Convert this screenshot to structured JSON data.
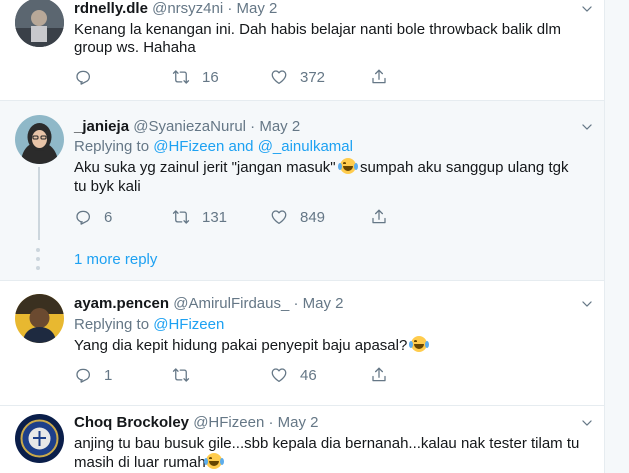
{
  "tweets": [
    {
      "name": "rdnelly.dle",
      "handle": "@nrsyz4ni",
      "dot": "·",
      "date": "May 2",
      "text_lines": [
        "Kenang la kenangan ini. Dah habis belajar nanti bole throwback balik dlm",
        "group ws. Hahaha"
      ],
      "retweets": "16",
      "likes": "372"
    },
    {
      "name": "_janieja",
      "handle": "@SyaniezaNurul",
      "dot": "·",
      "date": "May 2",
      "replying_prefix": "Replying to",
      "replying_1": "@HFizeen",
      "replying_and": "and",
      "replying_2": "@_ainulkamal",
      "text_line1_a": "Aku suka yg zainul jerit \"jangan masuk\"",
      "text_line1_b": "sumpah aku sanggup ulang tgk",
      "text_line2": "tu byk kali",
      "replies": "6",
      "retweets": "131",
      "likes": "849"
    },
    {
      "name": "ayam.pencen",
      "handle": "@AmirulFirdaus_",
      "dot": "·",
      "date": "May 2",
      "replying_prefix": "Replying to",
      "replying_1": "@HFizeen",
      "text": "Yang dia kepit hidung pakai penyepit baju apasal?",
      "replies": "1",
      "likes": "46"
    },
    {
      "name": "Choq Brockoley",
      "handle": "@HFizeen",
      "dot": "·",
      "date": "May 2",
      "text_line1": "anjing tu bau busuk gile...sbb kepala dia bernanah...kalau nak tester tilam tu",
      "text_line2": "masih di luar rumah"
    }
  ],
  "more_replies": "1 more reply",
  "icons": [
    "reply-icon",
    "retweet-icon",
    "like-icon",
    "share-icon",
    "chevron-down-icon",
    "tears-of-joy-emoji"
  ],
  "colors": {
    "link": "#1da1f2",
    "muted": "#657786",
    "thread_bg": "#f5f8fa"
  }
}
